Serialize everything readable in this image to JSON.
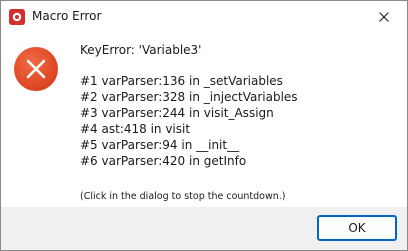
{
  "window": {
    "title": "Macro Error",
    "app_icon": "app-logo-icon",
    "close_icon": "close-icon",
    "accent_color": "#0067c0",
    "error_color": "#e34a26"
  },
  "dialog": {
    "icon": "error-x-icon",
    "headline": "KeyError: 'Variable3'",
    "traceback": [
      "#1 varParser:136 in _setVariables",
      "#2 varParser:328 in _injectVariables",
      "#3 varParser:244 in visit_Assign",
      "#4 ast:418 in visit",
      "#5 varParser:94 in __init__",
      "#6 varParser:420 in getInfo"
    ],
    "footnote": "(Click in the dialog to stop the countdown.)"
  },
  "buttons": {
    "ok_label": "OK"
  }
}
